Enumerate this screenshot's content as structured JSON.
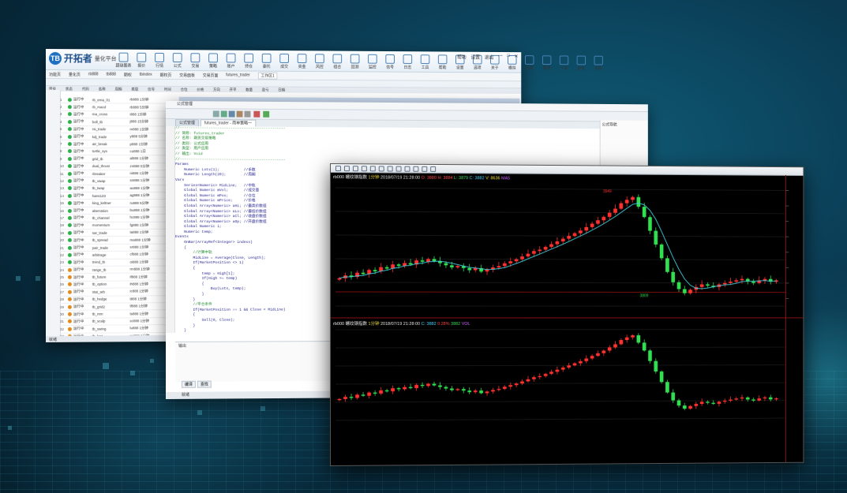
{
  "main_window": {
    "logo_text": "开拓者",
    "logo_sub": "量化平台",
    "window_controls": [
      "帮助",
      "设置",
      "退出"
    ],
    "ribbon": [
      "超级图表",
      "报价",
      "行情",
      "公式",
      "交易",
      "策略",
      "账户",
      "持仓",
      "委托",
      "成交",
      "资金",
      "风控",
      "组合",
      "回测",
      "监控",
      "信号",
      "日志",
      "工具",
      "帮助",
      "设置",
      "选项",
      "关于",
      "模拟",
      "实盘",
      "数据",
      "下载",
      "更新",
      "系统"
    ],
    "tabs": [
      "功能页",
      "量化页",
      "rb888",
      "tb888",
      "期权",
      "tbindex",
      "期权页",
      "交易面板",
      "交易页面",
      "futures_trader",
      "工作区1"
    ],
    "columns": [
      "序号",
      "状态",
      "代码",
      "名称",
      "周期",
      "类型",
      "信号",
      "时间",
      "仓位",
      "价格",
      "方向",
      "开平",
      "数量",
      "盈亏",
      "日期"
    ],
    "rows": [
      {
        "n": "1",
        "status": "运行中",
        "code": "rb_ema_01",
        "desc": "rb888 1分钟"
      },
      {
        "n": "2",
        "status": "运行中",
        "code": "rb_macd",
        "desc": "rb888 5分钟"
      },
      {
        "n": "3",
        "status": "运行中",
        "code": "ma_cross",
        "desc": "i888 1分钟"
      },
      {
        "n": "4",
        "status": "运行中",
        "code": "boll_tb",
        "desc": "j888 15分钟"
      },
      {
        "n": "5",
        "status": "运行中",
        "code": "rsi_trade",
        "desc": "m888 1分钟"
      },
      {
        "n": "6",
        "status": "运行中",
        "code": "kdj_trade",
        "desc": "y888 5分钟"
      },
      {
        "n": "7",
        "status": "运行中",
        "code": "atr_break",
        "desc": "p888 1分钟"
      },
      {
        "n": "8",
        "status": "运行中",
        "code": "turtle_sys",
        "desc": "cu888 1日"
      },
      {
        "n": "9",
        "status": "运行中",
        "code": "grid_tb",
        "desc": "al888 1分钟"
      },
      {
        "n": "10",
        "status": "运行中",
        "code": "dual_thrust",
        "desc": "zn888 5分钟"
      },
      {
        "n": "11",
        "status": "运行中",
        "code": "rbreaker",
        "desc": "ni888 1分钟"
      },
      {
        "n": "12",
        "status": "运行中",
        "code": "tb_vwap",
        "desc": "sn888 1分钟"
      },
      {
        "n": "13",
        "status": "运行中",
        "code": "tb_twap",
        "desc": "au888 1分钟"
      },
      {
        "n": "14",
        "status": "运行中",
        "code": "hans123",
        "desc": "ag888 1分钟"
      },
      {
        "n": "15",
        "status": "运行中",
        "code": "king_keltner",
        "desc": "ru888 5分钟"
      },
      {
        "n": "16",
        "status": "运行中",
        "code": "aberration",
        "desc": "bu888 1分钟"
      },
      {
        "n": "17",
        "status": "运行中",
        "code": "tb_channel",
        "desc": "hc888 1分钟"
      },
      {
        "n": "18",
        "status": "运行中",
        "code": "momentum",
        "desc": "fg888 1分钟"
      },
      {
        "n": "19",
        "status": "运行中",
        "code": "sar_trade",
        "desc": "ta888 1分钟"
      },
      {
        "n": "20",
        "status": "运行中",
        "code": "tb_spread",
        "desc": "ma888 1分钟"
      },
      {
        "n": "21",
        "status": "运行中",
        "code": "pair_trade",
        "desc": "sr888 1分钟"
      },
      {
        "n": "22",
        "status": "运行中",
        "code": "arbitrage",
        "desc": "cf888 1分钟"
      },
      {
        "n": "23",
        "status": "运行中",
        "code": "trend_tb",
        "desc": "oi888 1分钟"
      },
      {
        "n": "24",
        "status": "运行中",
        "code": "range_tb",
        "desc": "rm888 1分钟"
      },
      {
        "n": "25",
        "status": "运行中",
        "code": "tb_future",
        "desc": "if888 1分钟"
      },
      {
        "n": "26",
        "status": "运行中",
        "code": "tb_option",
        "desc": "ih888 1分钟"
      },
      {
        "n": "27",
        "status": "运行中",
        "code": "stat_arb",
        "desc": "ic888 1分钟"
      },
      {
        "n": "28",
        "status": "运行中",
        "code": "tb_hedge",
        "desc": "t888 1分钟"
      },
      {
        "n": "29",
        "status": "运行中",
        "code": "tb_grid2",
        "desc": "tf888 1分钟"
      },
      {
        "n": "30",
        "status": "运行中",
        "code": "tb_mm",
        "desc": "ts888 1分钟"
      },
      {
        "n": "31",
        "status": "运行中",
        "code": "tb_scalp",
        "desc": "sc888 1分钟"
      },
      {
        "n": "32",
        "status": "运行中",
        "code": "tb_swing",
        "desc": "lu888 1分钟"
      },
      {
        "n": "33",
        "status": "运行中",
        "code": "tb_last",
        "desc": "pg888 1分钟"
      }
    ],
    "status_text": "就绪"
  },
  "formula_editor": {
    "title": "公式管理",
    "tabs": [
      "公式管理",
      "futures_trader - 简单策略一"
    ],
    "side_panel_title": "公式导航",
    "code_lines": [
      "//------------------------------------------------",
      "// 简称: futures_trader",
      "// 名称: 期货交易策略",
      "// 类别: 公式应用",
      "// 类型: 用户应用",
      "// 输出: Void",
      "//------------------------------------------------",
      "Params",
      "    Numeric Lots(1);           //手数",
      "    Numeric Length(20);        //周期",
      "Vars",
      "    Series<Numeric> MidLine;   //中轨",
      "    Global Numeric mVol;       //成交量",
      "    Global Numeric mPos;       //仓位",
      "    Global Numeric mPrice;     //价格",
      "    Global Array<Numeric> aHi; //最高价数组",
      "    Global Array<Numeric> aLo; //最低价数组",
      "    Global Array<Numeric> aCl; //收盘价数组",
      "    Global Array<Numeric> aOp; //开盘价数组",
      "    Global Numeric i;",
      "    Numeric temp;",
      "Events",
      "    OnBar(ArrayRef<Integer> indexs)",
      "    {",
      "        //计算中轨",
      "        MidLine = Average(Close, Length);",
      "        If(MarketPosition <> 1)",
      "        {",
      "            temp = High[1];",
      "            If(High >= temp)",
      "            {",
      "                Buy(Lots, temp);",
      "            }",
      "        }",
      "        //平仓条件",
      "        If(MarketPosition == 1 && Close < MidLine)",
      "        {",
      "            Sell(0, Close);",
      "        }",
      "    }"
    ],
    "output_tab": "输出",
    "bottom_tabs": [
      "编译",
      "查找"
    ],
    "status": "就绪"
  },
  "chart_window": {
    "top_info": {
      "symbol": "rb000 螺纹钢指数",
      "period": "1分钟",
      "time": "2018/07/19 21:28:00",
      "open": "O: 3880",
      "high": "H: 3884",
      "low": "L: 3879",
      "close": "C: 3882",
      "vol": "V: 8636",
      "ind": "MA5"
    },
    "bottom_info": {
      "symbol": "rb000 螺纹钢指数",
      "period": "1分钟",
      "time": "2018/07/19 21:28:00",
      "v1": "C: 3882",
      "v2": "0.28%",
      "v3": "3882",
      "ind": "VOL"
    },
    "price_markers": {
      "top_high": "3949",
      "low_marker": "3809"
    },
    "colors": {
      "up": "#ff3030",
      "down": "#30e050",
      "ma": "#40d0e0",
      "ma2": "#e0e040",
      "bg": "#000000",
      "axis": "#8a1010"
    }
  },
  "chart_data": {
    "type": "candlestick",
    "title": "rb000 螺纹钢指数",
    "xlabel": "",
    "ylabel": "",
    "series": [
      {
        "name": "MA5",
        "values": []
      }
    ],
    "close": [
      3830,
      3834,
      3832,
      3838,
      3836,
      3842,
      3840,
      3846,
      3844,
      3850,
      3848,
      3852,
      3850,
      3856,
      3854,
      3858,
      3855,
      3852,
      3849,
      3846,
      3848,
      3845,
      3842,
      3845,
      3840,
      3843,
      3846,
      3848,
      3852,
      3855,
      3858,
      3862,
      3866,
      3870,
      3872,
      3876,
      3880,
      3884,
      3888,
      3892,
      3896,
      3900,
      3905,
      3910,
      3915,
      3920,
      3926,
      3932,
      3940,
      3945,
      3949,
      3935,
      3920,
      3900,
      3880,
      3860,
      3840,
      3825,
      3815,
      3809,
      3814,
      3818,
      3822,
      3820,
      3818,
      3822,
      3824,
      3826,
      3828,
      3830,
      3826,
      3824,
      3828,
      3830,
      3826,
      3828
    ],
    "ylim": [
      3790,
      3960
    ]
  }
}
